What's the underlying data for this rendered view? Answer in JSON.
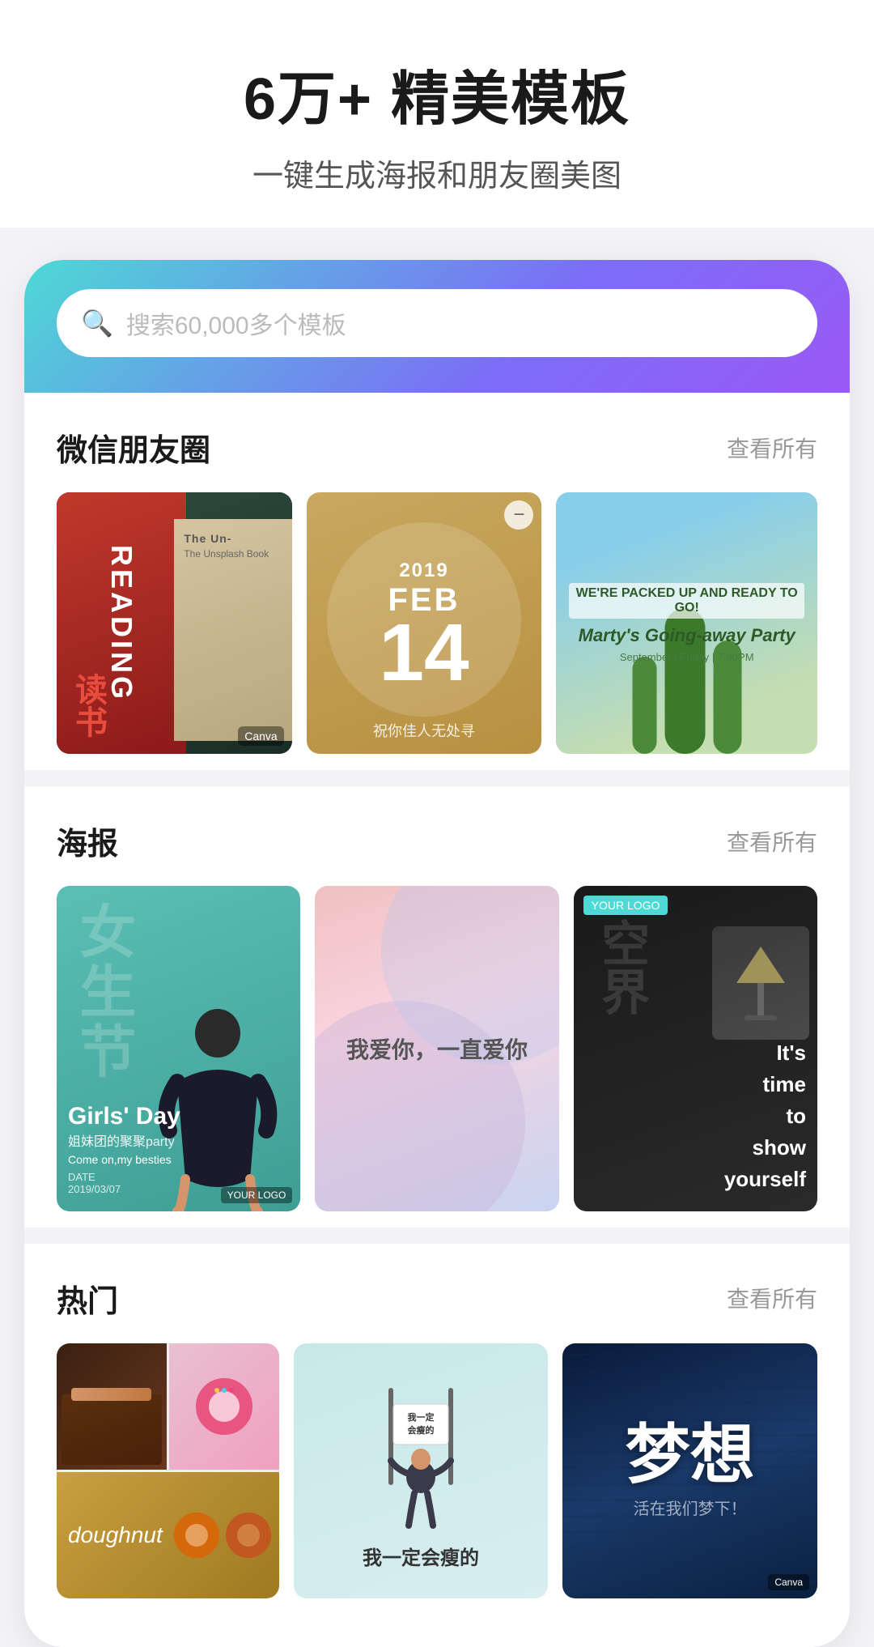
{
  "hero": {
    "title": "6万+ 精美模板",
    "subtitle": "一键生成海报和朋友圈美图"
  },
  "search": {
    "placeholder": "搜索60,000多个模板"
  },
  "sections": {
    "wechat": {
      "title": "微信朋友圈",
      "more": "查看所有",
      "cards": [
        {
          "text_vertical": "读书",
          "label": "READING"
        },
        {
          "year": "2019",
          "month": "FEB",
          "day": "14",
          "sub": "祝你佳人无处寻"
        },
        {
          "title": "Marty's Going-away Party",
          "sub": "September | Friday | 7:00PM"
        }
      ]
    },
    "poster": {
      "title": "海报",
      "more": "查看所有",
      "cards": [
        {
          "vertical_text": "女生节",
          "tag": "Girls' Day",
          "subtitle": "姐妹团的聚聚Party",
          "cta": "Come on,my besties",
          "date": "DATE 2019/03/07"
        },
        {
          "text": "我爱你，一直爱你"
        },
        {
          "vertical_text": "空界",
          "cta": "It's time to show yourself"
        }
      ]
    },
    "hot": {
      "title": "热门",
      "more": "查看所有",
      "cards": [
        {
          "label": "doughnut"
        },
        {
          "text": "我一定会瘦的"
        },
        {
          "main": "梦想",
          "sub": "活在我们梦下！"
        }
      ]
    }
  }
}
